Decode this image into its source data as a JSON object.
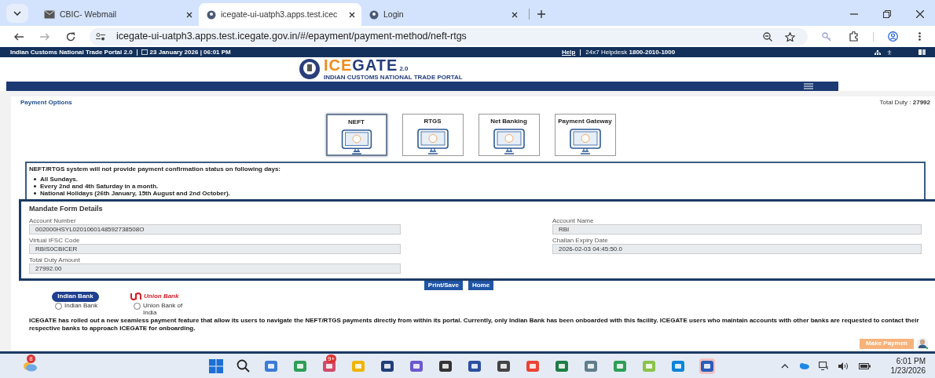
{
  "browser": {
    "tabs": [
      {
        "title": "CBIC- Webmail",
        "kind": "mail",
        "selected": false
      },
      {
        "title": "icegate-ui-uatph3.apps.test.icec",
        "kind": "site",
        "selected": true
      },
      {
        "title": "Login",
        "kind": "site",
        "selected": false
      }
    ],
    "url": "icegate-ui-uatph3.apps.test.icegate.gov.in/#/epayment/payment-method/neft-rtgs"
  },
  "top_bar": {
    "portal": "Indian Customs National Trade Portal 2.0",
    "datetime": "23 January 2026 | 06:01 PM",
    "help": "Help",
    "helpdesk_label": "24x7 Helpdesk",
    "helpdesk_number": "1800-2010-1000"
  },
  "brand": {
    "name_part_1": "ICE",
    "name_part_2": "GATE",
    "version": "2.0",
    "tagline": "INDIAN CUSTOMS NATIONAL TRADE PORTAL"
  },
  "page": {
    "title": "Payment Options",
    "total_label": "Total Duty :",
    "total_value": "27992"
  },
  "payment_options": [
    {
      "label": "NEFT",
      "selected": true
    },
    {
      "label": "RTGS",
      "selected": false
    },
    {
      "label": "Net Banking",
      "selected": false
    },
    {
      "label": "Payment Gateway",
      "selected": false
    }
  ],
  "notice": {
    "heading": "NEFT/RTGS system will not provide payment confirmation status on following days:",
    "items": [
      "All Sundays.",
      "Every 2nd and 4th Saturday in a month.",
      "National Holidays (26th January, 15th August and 2nd October)."
    ]
  },
  "mandate": {
    "title": "Mandate Form Details",
    "left_fields": [
      {
        "label": "Account Number",
        "value": "002000HSYL0201060148592738508O"
      },
      {
        "label": "Virtual IFSC Code",
        "value": "RBIS0CBICER"
      },
      {
        "label": "Total Duty Amount",
        "value": "27992.00"
      }
    ],
    "right_fields": [
      {
        "label": "Account Name",
        "value": "RBI"
      },
      {
        "label": "Challan Expiry Date",
        "value": "2026-02-03 04:45:50.0"
      }
    ]
  },
  "buttons": [
    "Print/Save",
    "Home"
  ],
  "banks": [
    {
      "logo_text": "Indian Bank",
      "label": "Indian Bank",
      "selected": false,
      "color": "#1d3f8f"
    },
    {
      "logo_text": "Union Bank",
      "label": "Union Bank of India",
      "selected": false,
      "color": "#d71f26"
    }
  ],
  "info": "ICEGATE has rolled out a new seamless payment feature that allow its users to navigate the NEFT/RTGS payments directly from within its portal. Currently, only Indian Bank has been onboarded with this facility. ICEGATE users who maintain accounts with other banks are requested to contact their respective banks to approach ICEGATE for onboarding.",
  "make_payment": "Make Paymen",
  "taskbar": {
    "weather_badge": "8",
    "mail_badge": "9+",
    "time": "6:01 PM",
    "date": "1/23/2026"
  }
}
